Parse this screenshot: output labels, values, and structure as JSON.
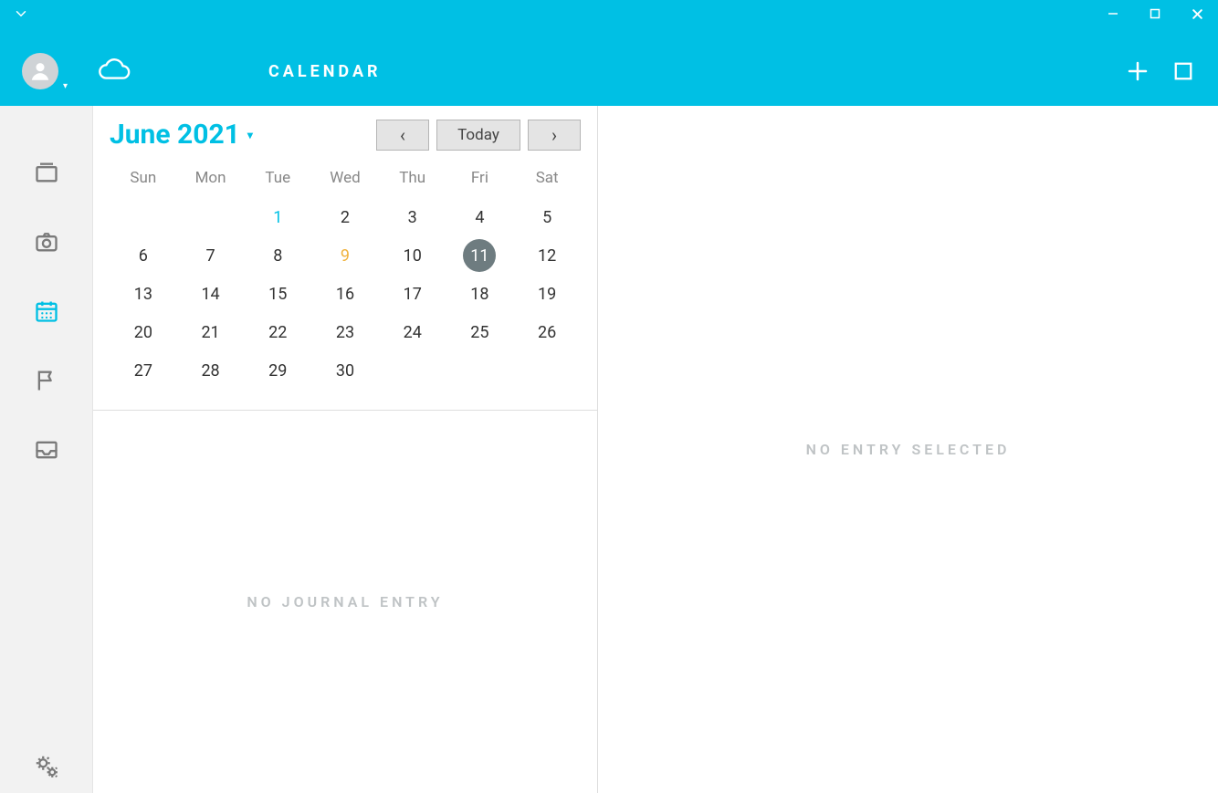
{
  "window": {
    "title": "CALENDAR"
  },
  "nav": {
    "prev_glyph": "‹",
    "next_glyph": "›",
    "today_label": "Today"
  },
  "calendar": {
    "month_label": "June 2021",
    "dow": [
      "Sun",
      "Mon",
      "Tue",
      "Wed",
      "Thu",
      "Fri",
      "Sat"
    ],
    "weeks": [
      [
        null,
        null,
        {
          "d": 1,
          "style": "cyan"
        },
        {
          "d": 2
        },
        {
          "d": 3
        },
        {
          "d": 4
        },
        {
          "d": 5
        }
      ],
      [
        {
          "d": 6
        },
        {
          "d": 7
        },
        {
          "d": 8
        },
        {
          "d": 9,
          "style": "orange"
        },
        {
          "d": 10
        },
        {
          "d": 11,
          "style": "selected"
        },
        {
          "d": 12
        }
      ],
      [
        {
          "d": 13
        },
        {
          "d": 14
        },
        {
          "d": 15
        },
        {
          "d": 16
        },
        {
          "d": 17
        },
        {
          "d": 18
        },
        {
          "d": 19
        }
      ],
      [
        {
          "d": 20
        },
        {
          "d": 21
        },
        {
          "d": 22
        },
        {
          "d": 23
        },
        {
          "d": 24
        },
        {
          "d": 25
        },
        {
          "d": 26
        }
      ],
      [
        {
          "d": 27
        },
        {
          "d": 28
        },
        {
          "d": 29
        },
        {
          "d": 30
        },
        null,
        null,
        null
      ]
    ]
  },
  "empty_states": {
    "journal": "NO JOURNAL ENTRY",
    "entry": "NO ENTRY SELECTED"
  }
}
